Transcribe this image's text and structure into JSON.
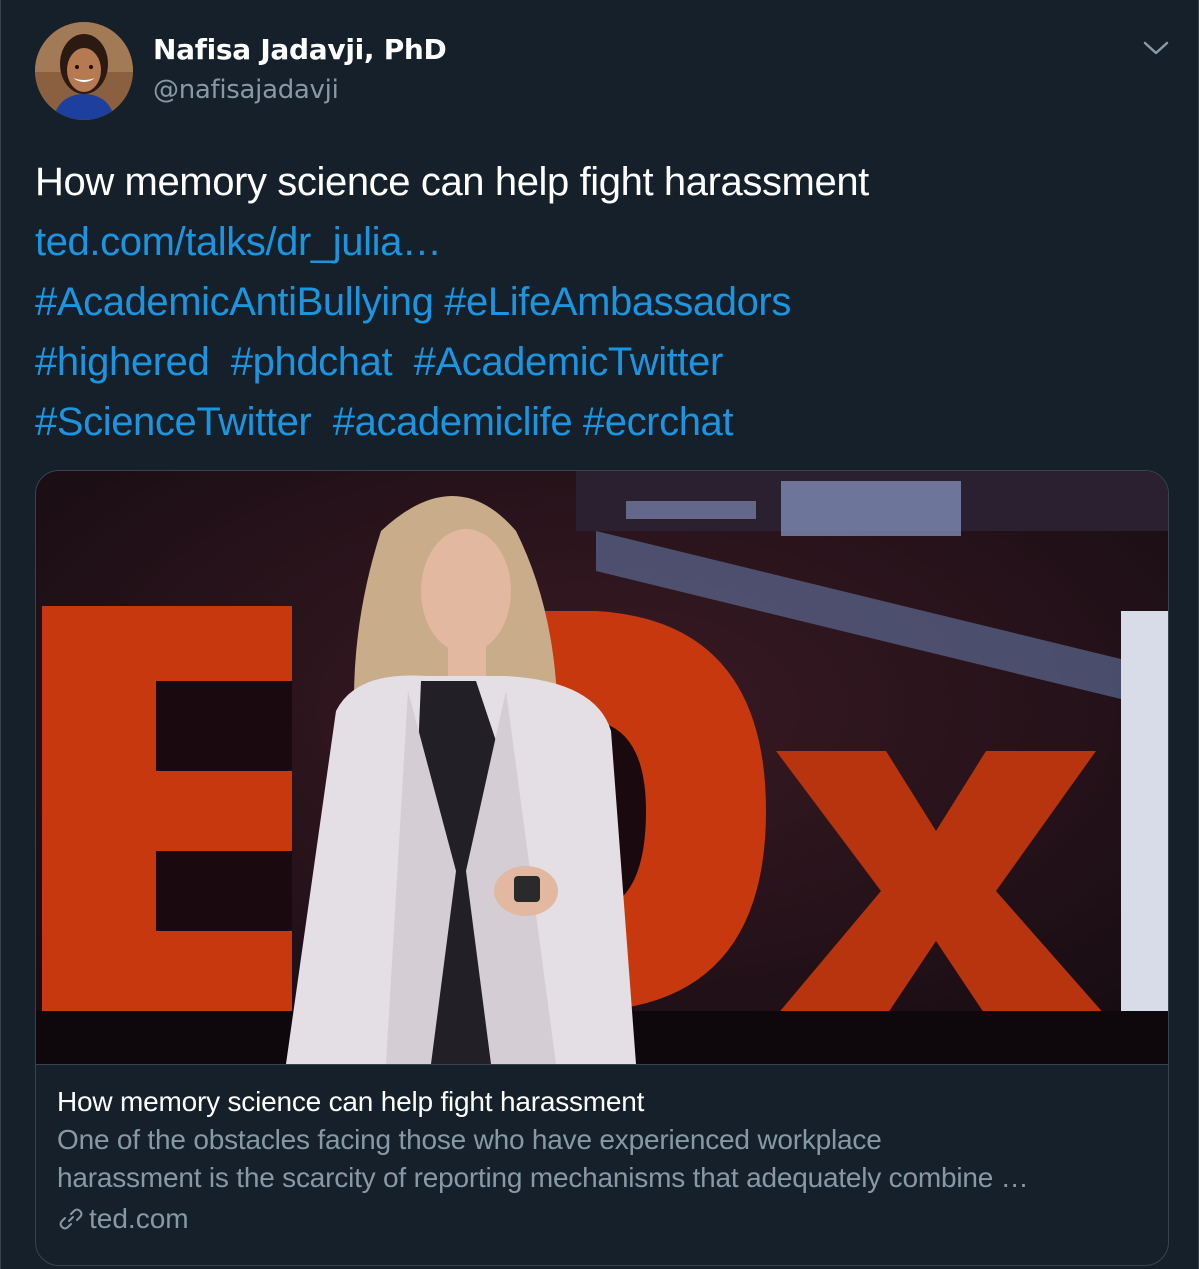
{
  "user": {
    "name": "Nafisa Jadavji, PhD",
    "handle": "@nafisajadavji"
  },
  "tweet": {
    "text": "How memory science can help fight harassment",
    "link": "ted.com/talks/dr_julia…",
    "hashtags_line1": [
      "#AcademicAntiBullying",
      "#eLifeAmbassadors"
    ],
    "hashtags_line2": [
      "#highered",
      "#phdchat",
      "#AcademicTwitter"
    ],
    "hashtags_line3": [
      "#ScienceTwitter",
      "#academiclife",
      "#ecrchat"
    ]
  },
  "card": {
    "title": "How memory science can help fight harassment",
    "desc_line1": "One of the obstacles facing those who have experienced workplace",
    "desc_line2": "harassment is the scarcity of reporting mechanisms that adequately combine …",
    "domain": "ted.com",
    "image_text": "EDxL"
  },
  "icons": {
    "caret": "chevron-down-icon",
    "link": "link-icon"
  },
  "colors": {
    "background": "#15202b",
    "link": "#1b95e0",
    "secondary": "#8899a6",
    "border": "#38444d"
  }
}
